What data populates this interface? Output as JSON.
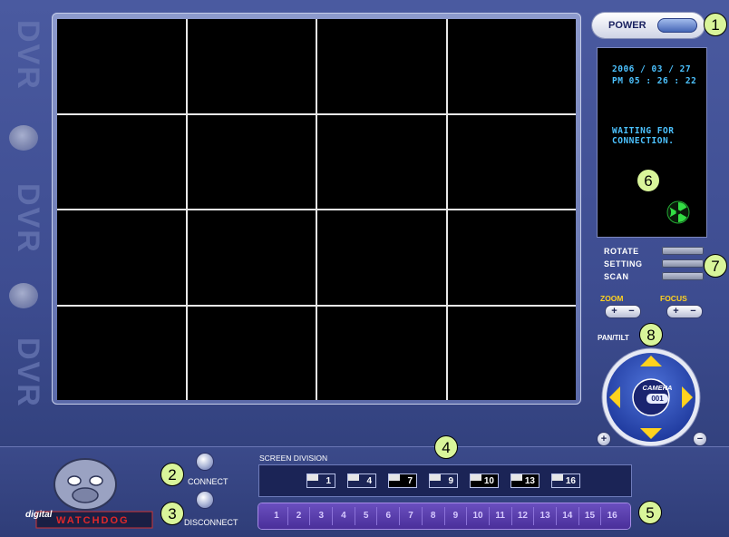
{
  "brand": {
    "side_text": "DVR",
    "logo_small": "digital",
    "logo_main": "WATCHDOG"
  },
  "power": {
    "label": "POWER"
  },
  "status": {
    "date": "2006 / 03 / 27",
    "time": "PM 05 : 26 : 22",
    "message_line1": "WAITING FOR",
    "message_line2": "CONNECTION.",
    "icon": "radiation-connection-icon"
  },
  "controls": {
    "rotate": "ROTATE",
    "setting": "SETTING",
    "scan": "SCAN"
  },
  "zoom": {
    "label": "ZOOM",
    "plus": "+",
    "minus": "−"
  },
  "focus": {
    "label": "FOCUS",
    "plus": "+",
    "minus": "−"
  },
  "pantilt": {
    "label": "PAN/TILT",
    "camera_label": "CAMERA",
    "camera_number": "001",
    "plus": "+",
    "minus": "−"
  },
  "connection": {
    "connect": "CONNECT",
    "disconnect": "DISCONNECT"
  },
  "screen_division": {
    "label": "SCREEN DIVISION",
    "options": [
      "1",
      "4",
      "7",
      "9",
      "10",
      "13",
      "16"
    ]
  },
  "cameras": [
    "1",
    "2",
    "3",
    "4",
    "5",
    "6",
    "7",
    "8",
    "9",
    "10",
    "11",
    "12",
    "13",
    "14",
    "15",
    "16"
  ],
  "callouts": [
    "1",
    "2",
    "3",
    "4",
    "5",
    "6",
    "7",
    "8"
  ],
  "colors": {
    "accent": "#4cc2ff",
    "yellow": "#ffd21e",
    "callout": "#d9f59a",
    "strip": "#5a3fb0"
  }
}
